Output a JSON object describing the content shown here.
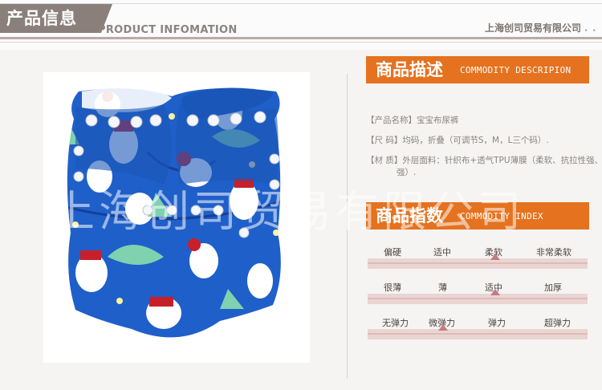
{
  "header": {
    "section_title": "产品信息",
    "section_subtitle": "PRODUCT INFOMATION",
    "company": "上海创司贸易有限公司"
  },
  "description": {
    "title_cn": "商品描述",
    "title_en": "COMMODITY DESCRIPION",
    "name_label": "【产品名称】",
    "name_value": "宝宝布尿裤",
    "size_label": "【尺 码】",
    "size_value": "均码，折叠（可调节S，M，L三个码）.",
    "material_label": "【材 质】",
    "material_value": "外层面料：针织布+透气TPU薄膜（柔软、抗拉性强、透气性强）."
  },
  "watermark": "上海创司贸易有限公司",
  "index": {
    "title_cn": "商品指数",
    "title_en": "COMMODITY INDEX",
    "scales": [
      {
        "labels": [
          "偏硬",
          "适中",
          "柔软",
          "非常柔软"
        ],
        "selected": 2
      },
      {
        "labels": [
          "很薄",
          "薄",
          "适中",
          "加厚"
        ],
        "selected": 2
      },
      {
        "labels": [
          "无弹力",
          "微弹力",
          "弹力",
          "超弹力"
        ],
        "selected": 1
      }
    ]
  },
  "colors": {
    "accent": "#e4721f",
    "header_tab": "#8a7f7a",
    "diaper_blue": "#1f5fc9",
    "scale_bar": "#ead5d2",
    "marker": "#c57a82"
  }
}
